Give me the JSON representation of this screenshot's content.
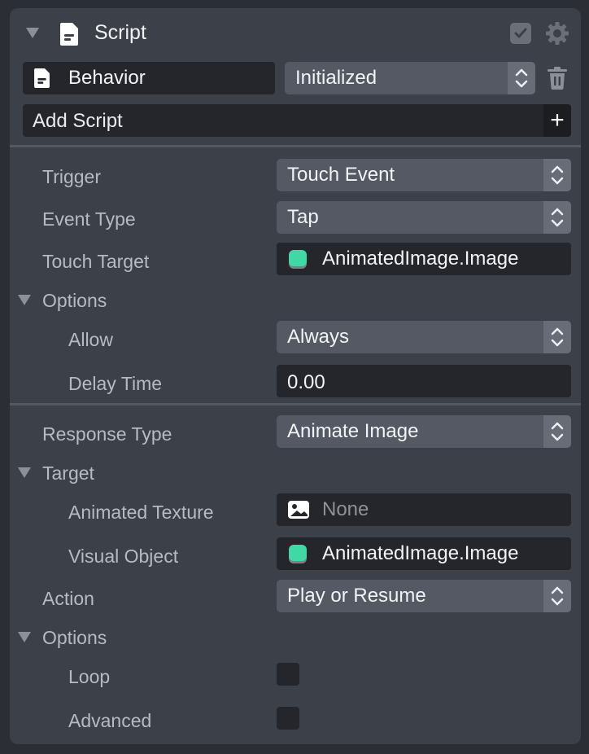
{
  "header": {
    "title": "Script"
  },
  "script_row": {
    "name": "Behavior",
    "event": "Initialized"
  },
  "add_script": {
    "label": "Add Script",
    "plus": "+"
  },
  "trigger": {
    "trigger_label": "Trigger",
    "trigger_value": "Touch Event",
    "event_type_label": "Event Type",
    "event_type_value": "Tap",
    "touch_target_label": "Touch Target",
    "touch_target_value": "AnimatedImage.Image",
    "options_label": "Options",
    "allow_label": "Allow",
    "allow_value": "Always",
    "delay_label": "Delay Time",
    "delay_value": "0.00"
  },
  "response": {
    "response_type_label": "Response Type",
    "response_type_value": "Animate Image",
    "target_label": "Target",
    "texture_label": "Animated Texture",
    "texture_value": "None",
    "visual_label": "Visual Object",
    "visual_value": "AnimatedImage.Image",
    "action_label": "Action",
    "action_value": "Play or Resume",
    "options_label": "Options",
    "loop_label": "Loop",
    "advanced_label": "Advanced"
  },
  "colors": {
    "panel_bg": "#3c4049",
    "field_dark": "#24262b",
    "select_bg": "#545963",
    "object_icon": "#3fd9a5"
  }
}
